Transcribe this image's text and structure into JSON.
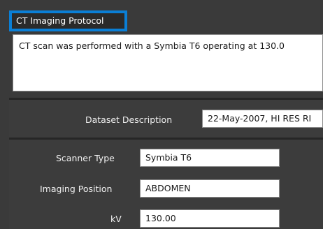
{
  "protocol": {
    "title": "CT Imaging Protocol",
    "text": "CT scan was performed with a Symbia T6 operating at 130.0"
  },
  "dataset": {
    "label": "Dataset Description",
    "value": "22-May-2007, HI RES  RI"
  },
  "fields": {
    "scanner_type": {
      "label": "Scanner Type",
      "value": "Symbia T6"
    },
    "imaging_position": {
      "label": "Imaging Position",
      "value": "ABDOMEN"
    },
    "kv": {
      "label": "kV",
      "value": "130.00"
    }
  }
}
